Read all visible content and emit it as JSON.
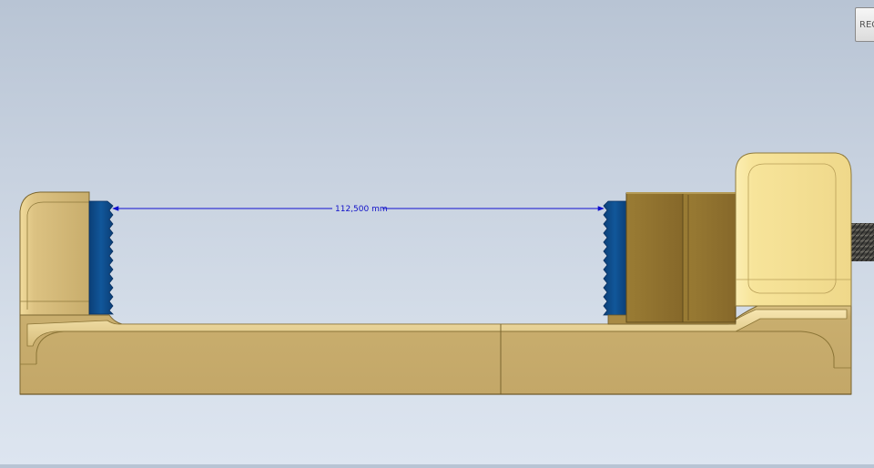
{
  "viewport": {
    "dimension_text": "112,500 mm",
    "corner_button_label": "REC"
  },
  "colors": {
    "body": "#c8ad6d",
    "body_highlight": "#e6cf92",
    "right_block": "#f6e49a",
    "sliding_jaw": "#8d702e",
    "jaw_plate": "#0d4a86",
    "dimension": "#1010d0",
    "outline": "#6e5a2a"
  },
  "icons": {
    "dimension_arrow": "arrowhead"
  }
}
